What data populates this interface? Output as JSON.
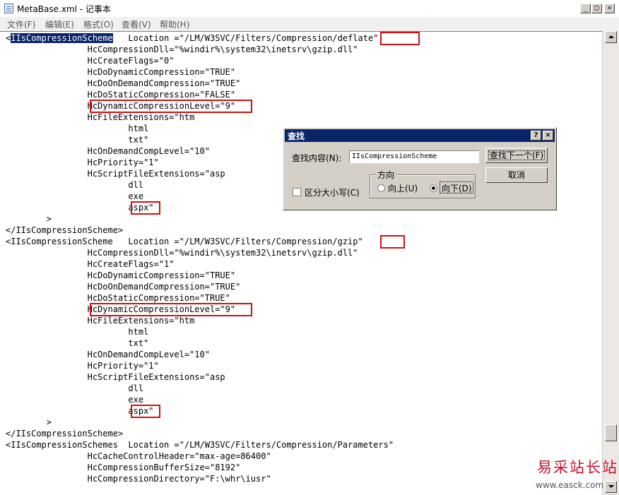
{
  "window": {
    "title": "MetaBase.xml - 记事本",
    "minimize_glyph": "_",
    "maximize_glyph": "□",
    "close_glyph": "×"
  },
  "menu": {
    "items": [
      "文件(F)",
      "编辑(E)",
      "格式(O)",
      "查看(V)",
      "帮助(H)"
    ]
  },
  "editor": {
    "lines": [
      {
        "text": "<IIsCompressionScheme   Location =\"/LM/W3SVC/Filters/Compression/deflate\"",
        "selected": "IIsCompressionScheme"
      },
      {
        "text": "                HcCompressionDll=\"%windir%\\system32\\inetsrv\\gzip.dll\""
      },
      {
        "text": "                HcCreateFlags=\"0\""
      },
      {
        "text": "                HcDoDynamicCompression=\"TRUE\""
      },
      {
        "text": "                HcDoOnDemandCompression=\"TRUE\""
      },
      {
        "text": "                HcDoStaticCompression=\"FALSE\""
      },
      {
        "text": "                HcDynamicCompressionLevel=\"9\""
      },
      {
        "text": "                HcFileExtensions=\"htm"
      },
      {
        "text": "                        html"
      },
      {
        "text": "                        txt\""
      },
      {
        "text": "                HcOnDemandCompLevel=\"10\""
      },
      {
        "text": "                HcPriority=\"1\""
      },
      {
        "text": "                HcScriptFileExtensions=\"asp"
      },
      {
        "text": "                        dll"
      },
      {
        "text": "                        exe"
      },
      {
        "text": "                        aspx\""
      },
      {
        "text": "        >"
      },
      {
        "text": "</IIsCompressionScheme>"
      },
      {
        "text": "<IIsCompressionScheme   Location =\"/LM/W3SVC/Filters/Compression/gzip\""
      },
      {
        "text": "                HcCompressionDll=\"%windir%\\system32\\inetsrv\\gzip.dll\""
      },
      {
        "text": "                HcCreateFlags=\"1\""
      },
      {
        "text": "                HcDoDynamicCompression=\"TRUE\""
      },
      {
        "text": "                HcDoOnDemandCompression=\"TRUE\""
      },
      {
        "text": "                HcDoStaticCompression=\"TRUE\""
      },
      {
        "text": "                HcDynamicCompressionLevel=\"9\""
      },
      {
        "text": "                HcFileExtensions=\"htm"
      },
      {
        "text": "                        html"
      },
      {
        "text": "                        txt\""
      },
      {
        "text": "                HcOnDemandCompLevel=\"10\""
      },
      {
        "text": "                HcPriority=\"1\""
      },
      {
        "text": "                HcScriptFileExtensions=\"asp"
      },
      {
        "text": "                        dll"
      },
      {
        "text": "                        exe"
      },
      {
        "text": "                        aspx\""
      },
      {
        "text": "        >"
      },
      {
        "text": "</IIsCompressionScheme>"
      },
      {
        "text": "<IIsCompressionSchemes  Location =\"/LM/W3SVC/Filters/Compression/Parameters\""
      },
      {
        "text": "                HcCacheControlHeader=\"max-age=86400\""
      },
      {
        "text": "                HcCompressionBufferSize=\"8192\""
      },
      {
        "text": "                HcCompressionDirectory=\"F:\\whr\\iusr\""
      }
    ],
    "selection_color": "#0a246a",
    "highlight_color": "#d01010"
  },
  "find_dialog": {
    "title": "查找",
    "help_glyph": "?",
    "close_glyph": "×",
    "find_label": "查找内容(N):",
    "find_value": "IIsCompressionScheme",
    "find_next_label": "查找下一个(F)",
    "cancel_label": "取消",
    "match_case_label": "区分大小写(C)",
    "match_case_checked": false,
    "direction_label": "方向",
    "up_label": "向上(U)",
    "down_label": "向下(D)",
    "direction_selected": "down"
  },
  "watermark": {
    "text": "易采站长站",
    "url": "www.easck.com"
  }
}
